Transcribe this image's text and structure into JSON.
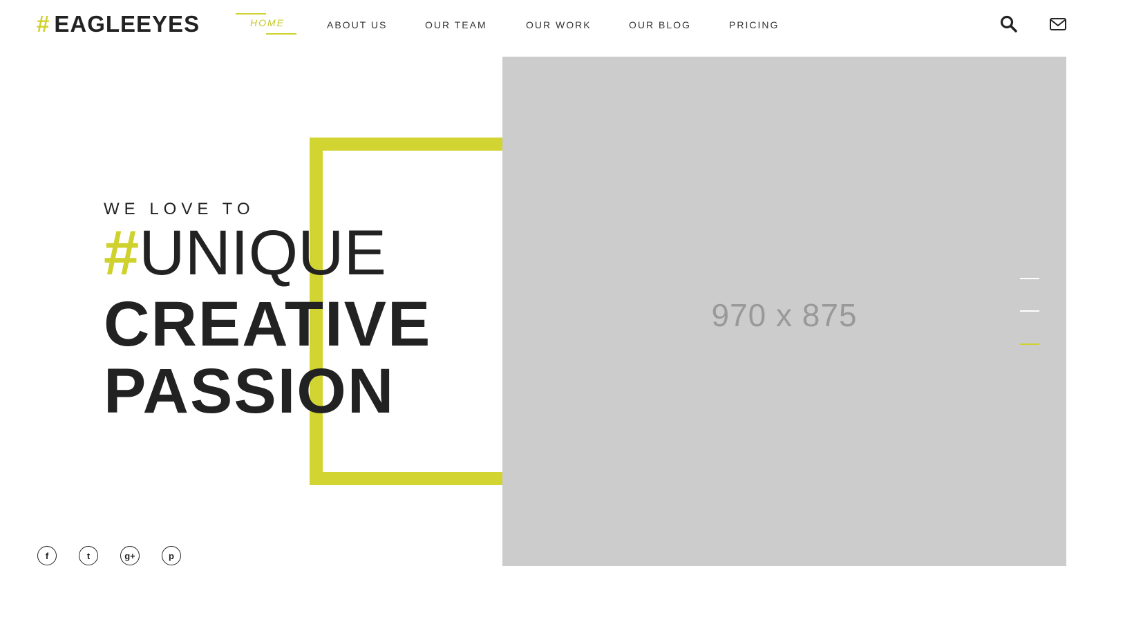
{
  "brand": {
    "hash": "#",
    "name": "EAGLEEYES",
    "accent_color": "#cfd22d"
  },
  "nav": {
    "items": [
      {
        "label": "HOME",
        "active": true
      },
      {
        "label": "ABOUT US",
        "active": false
      },
      {
        "label": "OUR TEAM",
        "active": false
      },
      {
        "label": "OUR WORK",
        "active": false
      },
      {
        "label": "OUR BLOG",
        "active": false
      },
      {
        "label": "PRICING",
        "active": false
      }
    ]
  },
  "header_icons": {
    "search": "search-icon",
    "mail": "mail-icon"
  },
  "hero": {
    "subtitle": "WE LOVE TO",
    "hash": "#",
    "line1": "UNIQUE",
    "line2": "CREATIVE",
    "line3": "PASSION",
    "image_placeholder": "970 x 875"
  },
  "slider": {
    "count": 3,
    "active_index": 2
  },
  "social": [
    {
      "name": "facebook-icon",
      "glyph": "f"
    },
    {
      "name": "twitter-icon",
      "glyph": "t"
    },
    {
      "name": "google-plus-icon",
      "glyph": "g+"
    },
    {
      "name": "pinterest-icon",
      "glyph": "p"
    }
  ]
}
